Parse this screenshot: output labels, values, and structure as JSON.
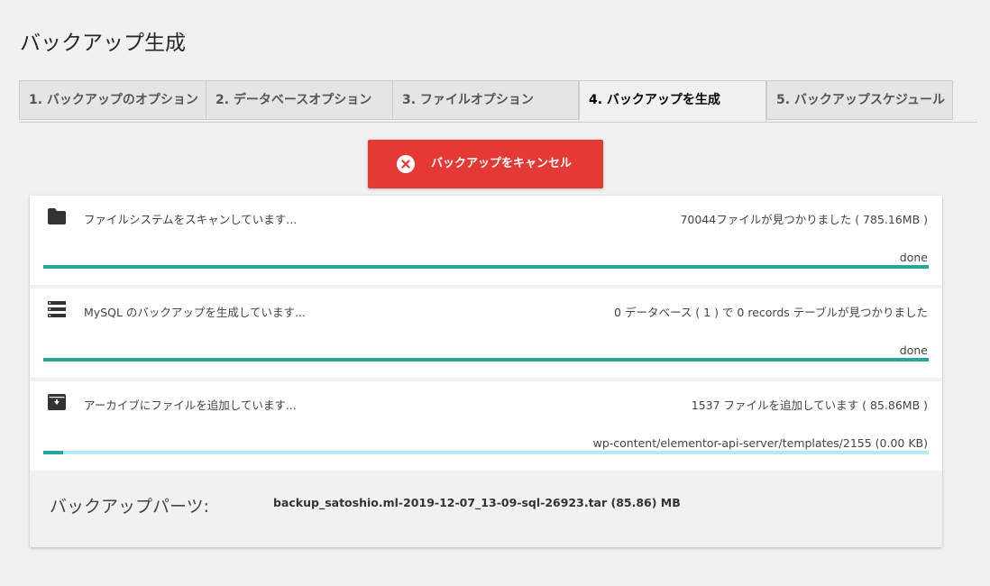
{
  "page": {
    "title": "バックアップ生成"
  },
  "tabs": [
    {
      "label": "1. バックアップのオプション",
      "active": false
    },
    {
      "label": "2. データベースオプション",
      "active": false
    },
    {
      "label": "3. ファイルオプション",
      "active": false
    },
    {
      "label": "4. バックアップを生成",
      "active": true
    },
    {
      "label": "5. バックアップスケジュール",
      "active": false
    }
  ],
  "cancel_button": {
    "label": "バックアップをキャンセル",
    "icon": "close-circle-icon",
    "color": "#e53935"
  },
  "steps": [
    {
      "icon": "folder-icon",
      "label": "ファイルシステムをスキャンしています...",
      "status": "70044ファイルが見つかりました ( 785.16MB )",
      "progress_text": "done",
      "progress": 1.0
    },
    {
      "icon": "database-list-icon",
      "label": "MySQL のバックアップを生成しています...",
      "status": "0 データベース ( 1 ) で 0 records テーブルが見つかりました",
      "progress_text": "done",
      "progress": 1.0
    },
    {
      "icon": "archive-icon",
      "label": "アーカイブにファイルを追加しています...",
      "status": "1537 ファイルを追加しています ( 85.86MB )",
      "progress_text": "wp-content/elementor-api-server/templates/2155 (0.00 KB)",
      "progress": 0.022
    }
  ],
  "backup_parts": {
    "label": "バックアップパーツ:",
    "file": "backup_satoshio.ml-2019-12-07_13-09-sql-26923.tar (85.86) MB"
  },
  "colors": {
    "progress_fill": "#26a69a",
    "progress_track": "#b2ebf2",
    "background": "#f1f1f1"
  }
}
